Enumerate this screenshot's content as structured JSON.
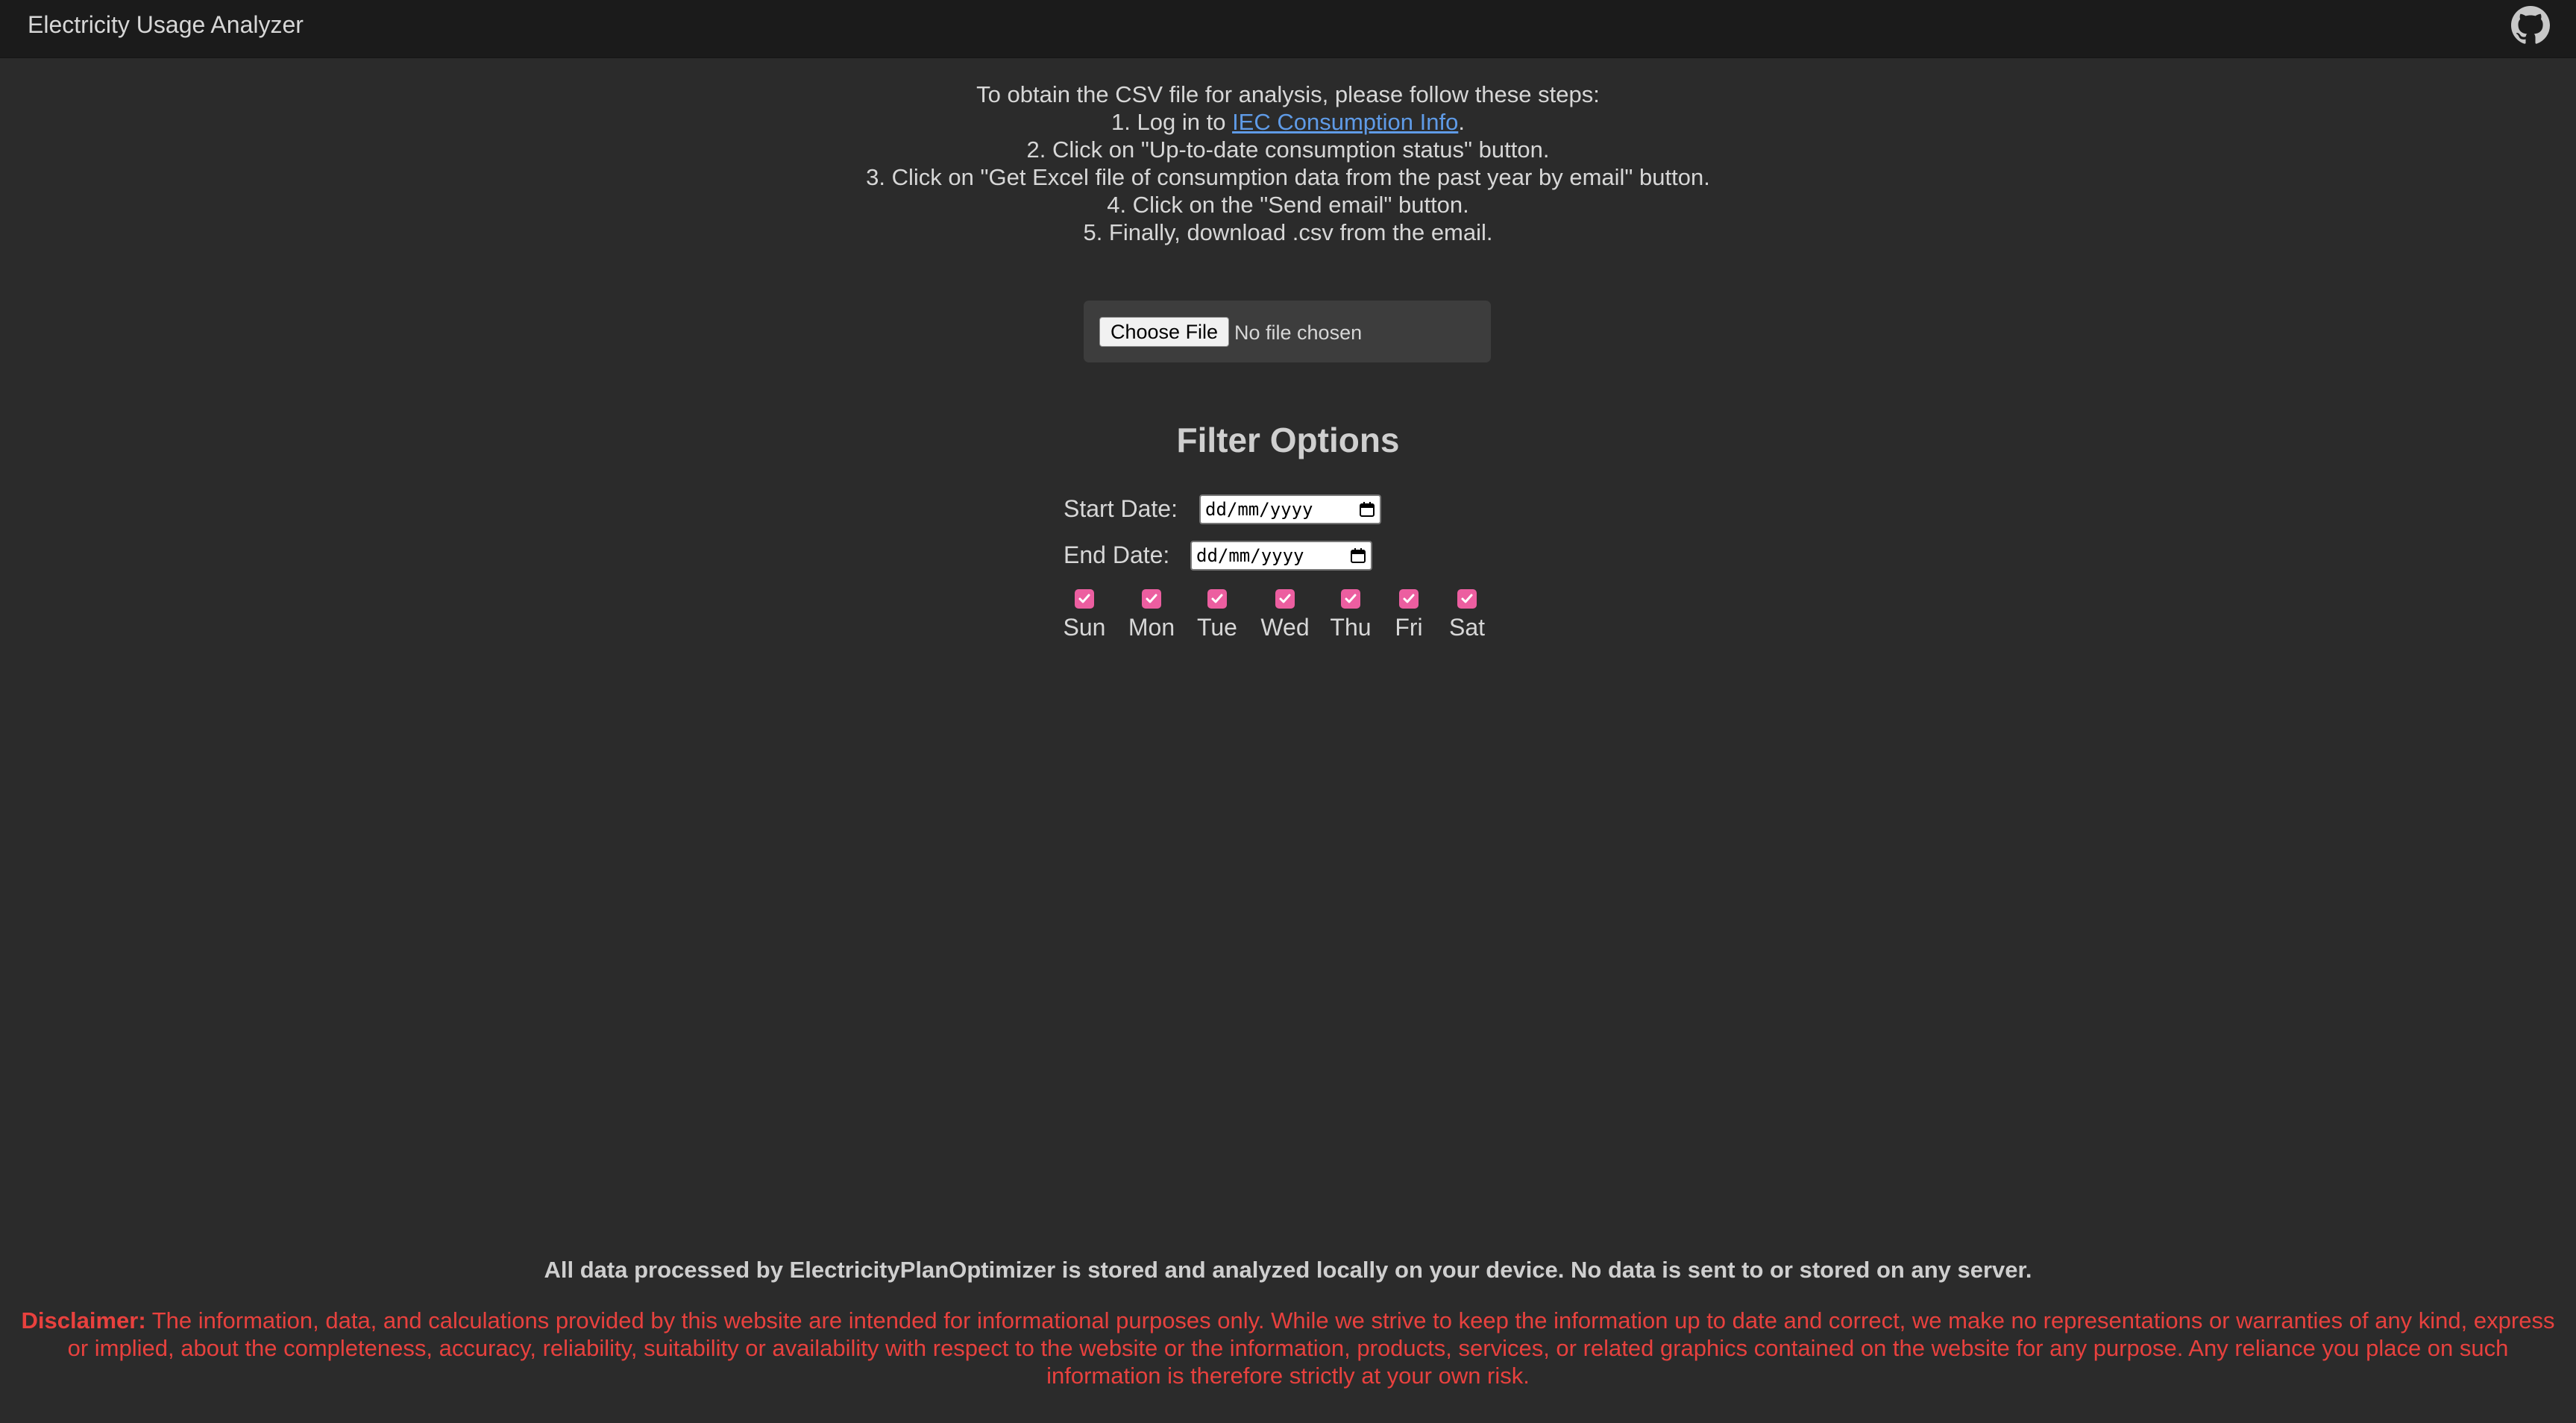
{
  "header": {
    "title": "Electricity Usage Analyzer",
    "github_icon": "github-icon"
  },
  "instructions": {
    "intro": "To obtain the CSV file for analysis, please follow these steps:",
    "step1_prefix": "1. Log in to ",
    "step1_link": "IEC Consumption Info",
    "step1_suffix": ".",
    "step2": "2. Click on \"Up-to-date consumption status\" button.",
    "step3": "3. Click on \"Get Excel file of consumption data from the past year by email\" button.",
    "step4": "4. Click on the \"Send email\" button.",
    "step5": "5. Finally, download .csv from the email."
  },
  "file_upload": {
    "button_label": "Choose File",
    "status": "No file chosen"
  },
  "filters": {
    "title": "Filter Options",
    "start_label": "Start Date:",
    "start_placeholder": "dd/mm/yyyy",
    "end_label": "End Date:",
    "end_placeholder": "dd/mm/yyyy",
    "days": [
      {
        "label": "Sun",
        "checked": true
      },
      {
        "label": "Mon",
        "checked": true
      },
      {
        "label": "Tue",
        "checked": true
      },
      {
        "label": "Wed",
        "checked": true
      },
      {
        "label": "Thu",
        "checked": true
      },
      {
        "label": "Fri",
        "checked": true
      },
      {
        "label": "Sat",
        "checked": true
      }
    ],
    "checkbox_color": "#ec5ea0"
  },
  "footer": {
    "privacy": "All data processed by ElectricityPlanOptimizer is stored and analyzed locally on your device. No data is sent to or stored on any server.",
    "disclaimer_label": "Disclaimer:",
    "disclaimer_text": " The information, data, and calculations provided by this website are intended for informational purposes only. While we strive to keep the information up to date and correct, we make no representations or warranties of any kind, express or implied, about the completeness, accuracy, reliability, suitability or availability with respect to the website or the information, products, services, or related graphics contained on the website for any purpose. Any reliance you place on such information is therefore strictly at your own risk.",
    "disclaimer_color": "#e8413e"
  }
}
